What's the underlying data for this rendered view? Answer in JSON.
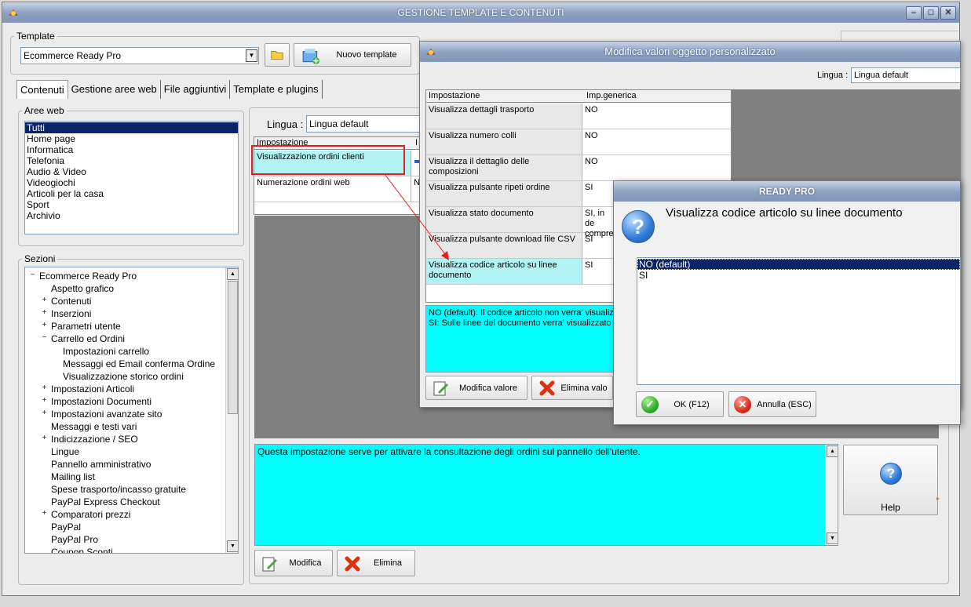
{
  "main_window": {
    "title": "GESTIONE TEMPLATE E CONTENUTI",
    "controls": {
      "minimize": "–",
      "maximize": "□",
      "close": "✕"
    }
  },
  "template_group": {
    "legend": "Template",
    "selected": "Ecommerce Ready Pro",
    "new_button": "Nuovo template"
  },
  "tabs": [
    "Contenuti",
    "Gestione aree web",
    "File aggiuntivi",
    "Template e plugins"
  ],
  "aree_web": {
    "legend": "Aree web",
    "items": [
      "Tutti",
      "Home page",
      "Informatica",
      "Telefonia",
      "Audio & Video",
      "Videogiochi",
      "Articoli per la casa",
      "Sport",
      "Archivio"
    ],
    "selected_index": 0
  },
  "sezioni": {
    "legend": "Sezioni",
    "nodes": [
      {
        "label": "Ecommerce Ready Pro",
        "expander": "−"
      },
      {
        "label": "Aspetto grafico",
        "expander": ""
      },
      {
        "label": "Contenuti",
        "expander": "+"
      },
      {
        "label": "Inserzioni",
        "expander": "+"
      },
      {
        "label": "Parametri utente",
        "expander": "+"
      },
      {
        "label": "Carrello ed Ordini",
        "expander": "−"
      },
      {
        "label": "Impostazioni carrello",
        "expander": ""
      },
      {
        "label": "Messaggi ed Email conferma Ordine",
        "expander": ""
      },
      {
        "label": "Visualizzazione storico ordini",
        "expander": ""
      },
      {
        "label": "Impostazioni Articoli",
        "expander": "+"
      },
      {
        "label": "Impostazioni Documenti",
        "expander": "+"
      },
      {
        "label": "Impostazioni avanzate sito",
        "expander": "+"
      },
      {
        "label": "Messaggi e testi vari",
        "expander": ""
      },
      {
        "label": "Indicizzazione / SEO",
        "expander": "+"
      },
      {
        "label": "Lingue",
        "expander": ""
      },
      {
        "label": "Pannello amministrativo",
        "expander": ""
      },
      {
        "label": "Mailing list",
        "expander": ""
      },
      {
        "label": "Spese trasporto/incasso gratuite",
        "expander": ""
      },
      {
        "label": "PayPal Express Checkout",
        "expander": ""
      },
      {
        "label": "Comparatori prezzi",
        "expander": "+"
      },
      {
        "label": "PayPal",
        "expander": ""
      },
      {
        "label": "PayPal Pro",
        "expander": ""
      },
      {
        "label": "Coupon Sconti",
        "expander": ""
      }
    ]
  },
  "content_panel": {
    "lingua_label": "Lingua :",
    "lingua_value": "Lingua default",
    "grid_headers": [
      "Impostazione",
      "I"
    ],
    "rows": [
      {
        "name": "Visualizzazione ordini clienti",
        "value": ""
      },
      {
        "name": "Numerazione ordini web",
        "value": "N"
      }
    ],
    "description": "Questa impostazione serve per attivare la consultazione degli ordini sul pannello dell'utente.",
    "modifica_button": "Modifica",
    "elimina_button": "Elimina",
    "help_button": "Help"
  },
  "edit_window": {
    "title": "Modifica valori oggetto personalizzato",
    "lingua_label": "Lingua :",
    "lingua_value": "Lingua default",
    "grid_headers": [
      "Impostazione",
      "Imp.generica"
    ],
    "rows": [
      {
        "name": "Visualizza dettagli trasporto",
        "value": "NO"
      },
      {
        "name": "Visualizza numero colli",
        "value": "NO"
      },
      {
        "name": "Visualizza il dettaglio delle composizioni",
        "value": "NO"
      },
      {
        "name": "Visualizza pulsante ripeti ordine",
        "value": "SI"
      },
      {
        "name": "Visualizza stato documento",
        "value": "SI, in de compre"
      },
      {
        "name": "Visualizza pulsante download file CSV",
        "value": "SI"
      },
      {
        "name": "Visualizza codice articolo su linee documento",
        "value": "SI"
      }
    ],
    "description_line1": "NO (default): Il codice articolo non verra' visualiza",
    "description_line2": "SI: Sulle linee del documento verra' visualizzato il",
    "modifica_button": "Modifica valore",
    "elimina_button": "Elimina valo"
  },
  "dialog": {
    "title": "READY PRO",
    "question": "Visualizza codice articolo su linee documento",
    "options": [
      "NO (default)",
      "SI"
    ],
    "selected_index": 0,
    "ok_button": "OK (F12)",
    "cancel_button": "Annulla (ESC)"
  },
  "colors": {
    "highlight": "#0a246a",
    "cyan": "#00ffff",
    "annotation": "#e02020"
  }
}
